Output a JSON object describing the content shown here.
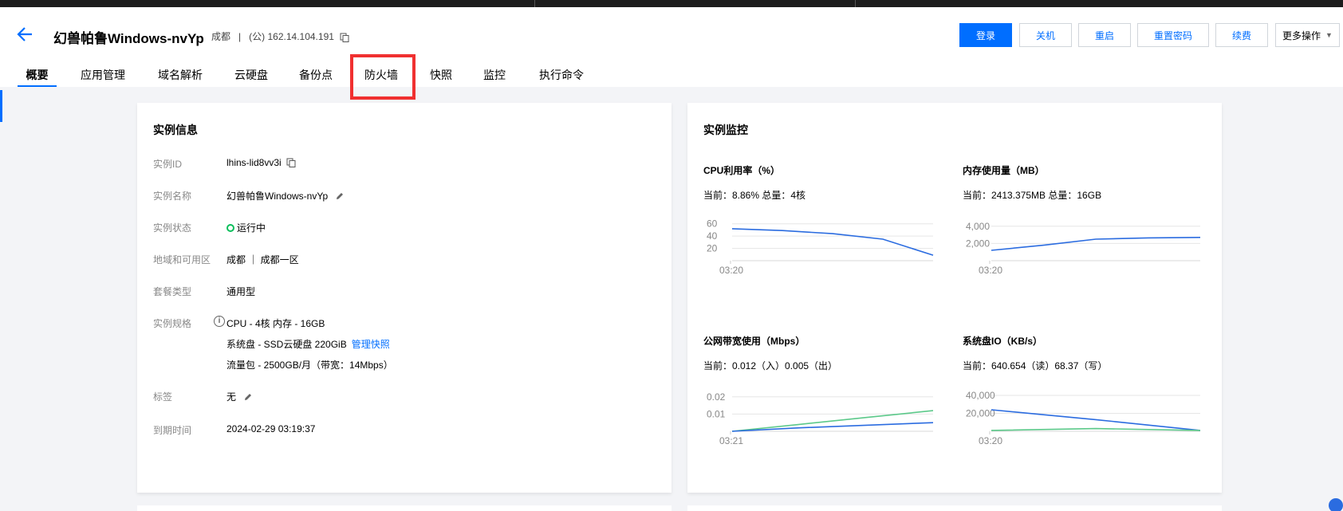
{
  "header": {
    "back_icon": "arrow-left-icon",
    "title": "幻兽帕鲁Windows-nvYp",
    "region": "成都",
    "divider": "|",
    "ip": "(公) 162.14.104.191",
    "copy_icon": "copy-icon"
  },
  "buttons": {
    "login": "登录",
    "shutdown": "关机",
    "restart": "重启",
    "reset_password": "重置密码",
    "renew": "续费",
    "more": "更多操作"
  },
  "tabs": [
    {
      "label": "概要",
      "active": true
    },
    {
      "label": "应用管理"
    },
    {
      "label": "域名解析"
    },
    {
      "label": "云硬盘"
    },
    {
      "label": "备份点"
    },
    {
      "label": "防火墙",
      "highlighted": true
    },
    {
      "label": "快照"
    },
    {
      "label": "监控"
    },
    {
      "label": "执行命令"
    }
  ],
  "instance_info": {
    "title": "实例信息",
    "id_label": "实例ID",
    "id_value": "lhins-lid8vv3i",
    "name_label": "实例名称",
    "name_value": "幻兽帕鲁Windows-nvYp",
    "status_label": "实例状态",
    "status_value": "运行中",
    "zone_label": "地域和可用区",
    "zone_value": "成都 ｜ 成都一区",
    "plan_label": "套餐类型",
    "plan_value": "通用型",
    "spec_label": "实例规格",
    "spec_cpu": "CPU - 4核 内存 - 16GB",
    "spec_disk": "系统盘 - SSD云硬盘 220GiB",
    "spec_disk_link": "管理快照",
    "spec_traffic": "流量包 - 2500GB/月（带宽：14Mbps）",
    "tag_label": "标签",
    "tag_value": "无",
    "expire_label": "到期时间",
    "expire_value": "2024-02-29 03:19:37"
  },
  "monitor": {
    "title": "实例监控",
    "cpu": {
      "label": "CPU利用率（%）",
      "current": "当前：8.86% 总量：4核"
    },
    "mem": {
      "label": "内存使用量（MB）",
      "current": "当前：2413.375MB 总量：16GB"
    },
    "net": {
      "label": "公网带宽使用（Mbps）",
      "current": "当前：0.012（入）0.005（出）"
    },
    "disk": {
      "label": "系统盘IO（KB/s）",
      "current": "当前：640.654（读）68.37（写）"
    }
  },
  "chart_data": [
    {
      "type": "line",
      "title": "CPU利用率（%）",
      "yticks": [
        "60",
        "40",
        "20"
      ],
      "xticks": [
        "03:20"
      ],
      "ylim": [
        0,
        70
      ],
      "series": [
        {
          "color": "#2b6ce0",
          "values": [
            52,
            49,
            44,
            35,
            9
          ]
        }
      ]
    },
    {
      "type": "line",
      "title": "内存使用量（MB）",
      "yticks": [
        "4,000",
        "2,000"
      ],
      "xticks": [
        "03:20"
      ],
      "ylim": [
        0,
        5000
      ],
      "series": [
        {
          "color": "#2b6ce0",
          "values": [
            1200,
            1800,
            2500,
            2650,
            2700
          ]
        }
      ]
    },
    {
      "type": "line",
      "title": "公网带宽使用（Mbps）",
      "yticks": [
        "0.02",
        "0.01"
      ],
      "xticks": [
        "03:21"
      ],
      "ylim": [
        0,
        0.025
      ],
      "series": [
        {
          "color": "#5cc98a",
          "values": [
            0.0,
            0.004,
            0.008,
            0.012
          ]
        },
        {
          "color": "#2b6ce0",
          "values": [
            0.0,
            0.002,
            0.0035,
            0.005
          ]
        }
      ]
    },
    {
      "type": "line",
      "title": "系统盘IO（KB/s）",
      "yticks": [
        "40,000",
        "20,000"
      ],
      "xticks": [
        "03:20"
      ],
      "ylim": [
        0,
        48000
      ],
      "series": [
        {
          "color": "#2b6ce0",
          "values": [
            24000,
            13000,
            1000
          ]
        },
        {
          "color": "#5cc98a",
          "values": [
            1000,
            3000,
            1000
          ]
        }
      ]
    }
  ]
}
